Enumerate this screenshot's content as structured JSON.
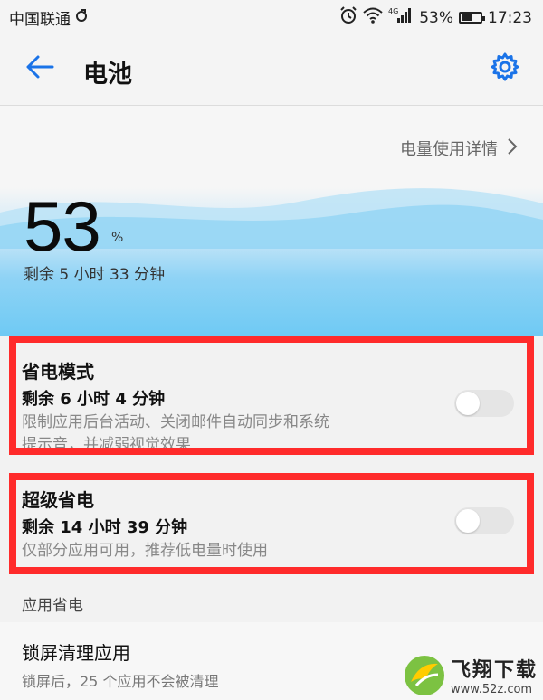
{
  "status_bar": {
    "carrier": "中国联通",
    "battery_percent": "53%",
    "time": "17:23",
    "icons": [
      "sync-icon",
      "alarm-icon",
      "wifi-icon",
      "signal-icon",
      "battery-icon"
    ],
    "network_type": "4G"
  },
  "app_bar": {
    "title": "电池",
    "back_icon": "arrow-left-icon",
    "settings_icon": "gear-icon",
    "accent_color": "#1a73e8"
  },
  "battery": {
    "usage_detail_link": "电量使用详情",
    "percent": "53",
    "unit": "%",
    "remaining": "剩余 5 小时 33 分钟"
  },
  "power_saving": {
    "title": "省电模式",
    "remaining": "剩余 6 小时 4 分钟",
    "description_line1": "限制应用后台活动、关闭邮件自动同步和系统",
    "description_line2": "提示音，并减弱视觉效果",
    "enabled": false
  },
  "ultra_power_saving": {
    "title": "超级省电",
    "remaining": "剩余 14 小时 39 分钟",
    "description": "仅部分应用可用，推荐低电量时使用",
    "enabled": false
  },
  "app_power_saving": {
    "section_label": "应用省电",
    "lock_screen_cleanup": {
      "title": "锁屏清理应用",
      "subtitle": "锁屏后，25 个应用不会被清理"
    }
  },
  "highlight_color": "#ff2b2b",
  "watermark": {
    "name": "飞翔下载",
    "url": "www.52z.com"
  }
}
